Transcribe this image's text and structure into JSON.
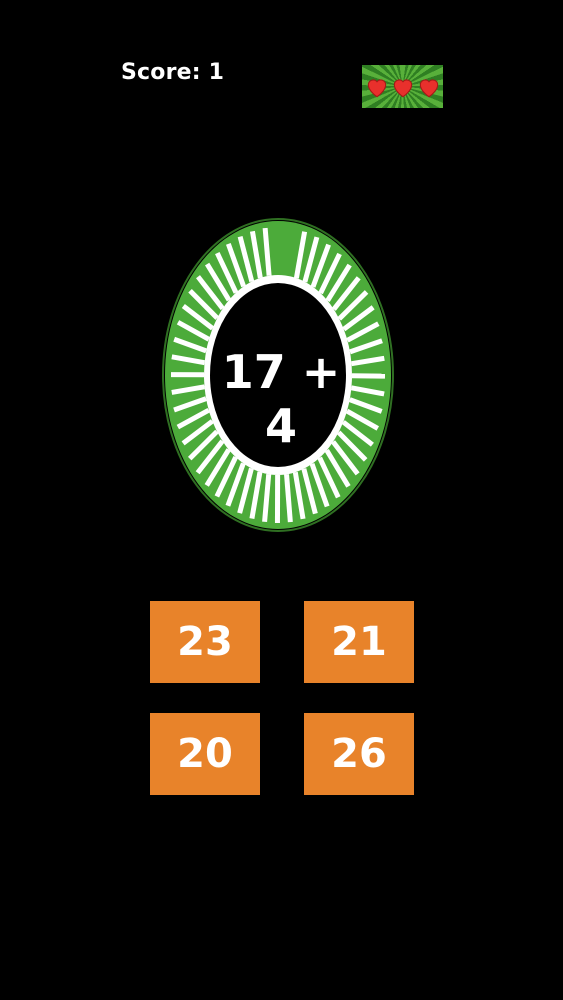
{
  "hud": {
    "score_label": "Score: 1",
    "lives": 3
  },
  "question": {
    "text": "17 + 4",
    "timer_remaining_fraction": 0.96
  },
  "answers": [
    "23",
    "21",
    "20",
    "26"
  ],
  "colors": {
    "background": "#000000",
    "timer_green": "#4cab3a",
    "timer_stripe": "#ffffff",
    "answer_button": "#e8832a",
    "heart": "#e8302c"
  },
  "icons": {
    "life": "heart-icon"
  }
}
